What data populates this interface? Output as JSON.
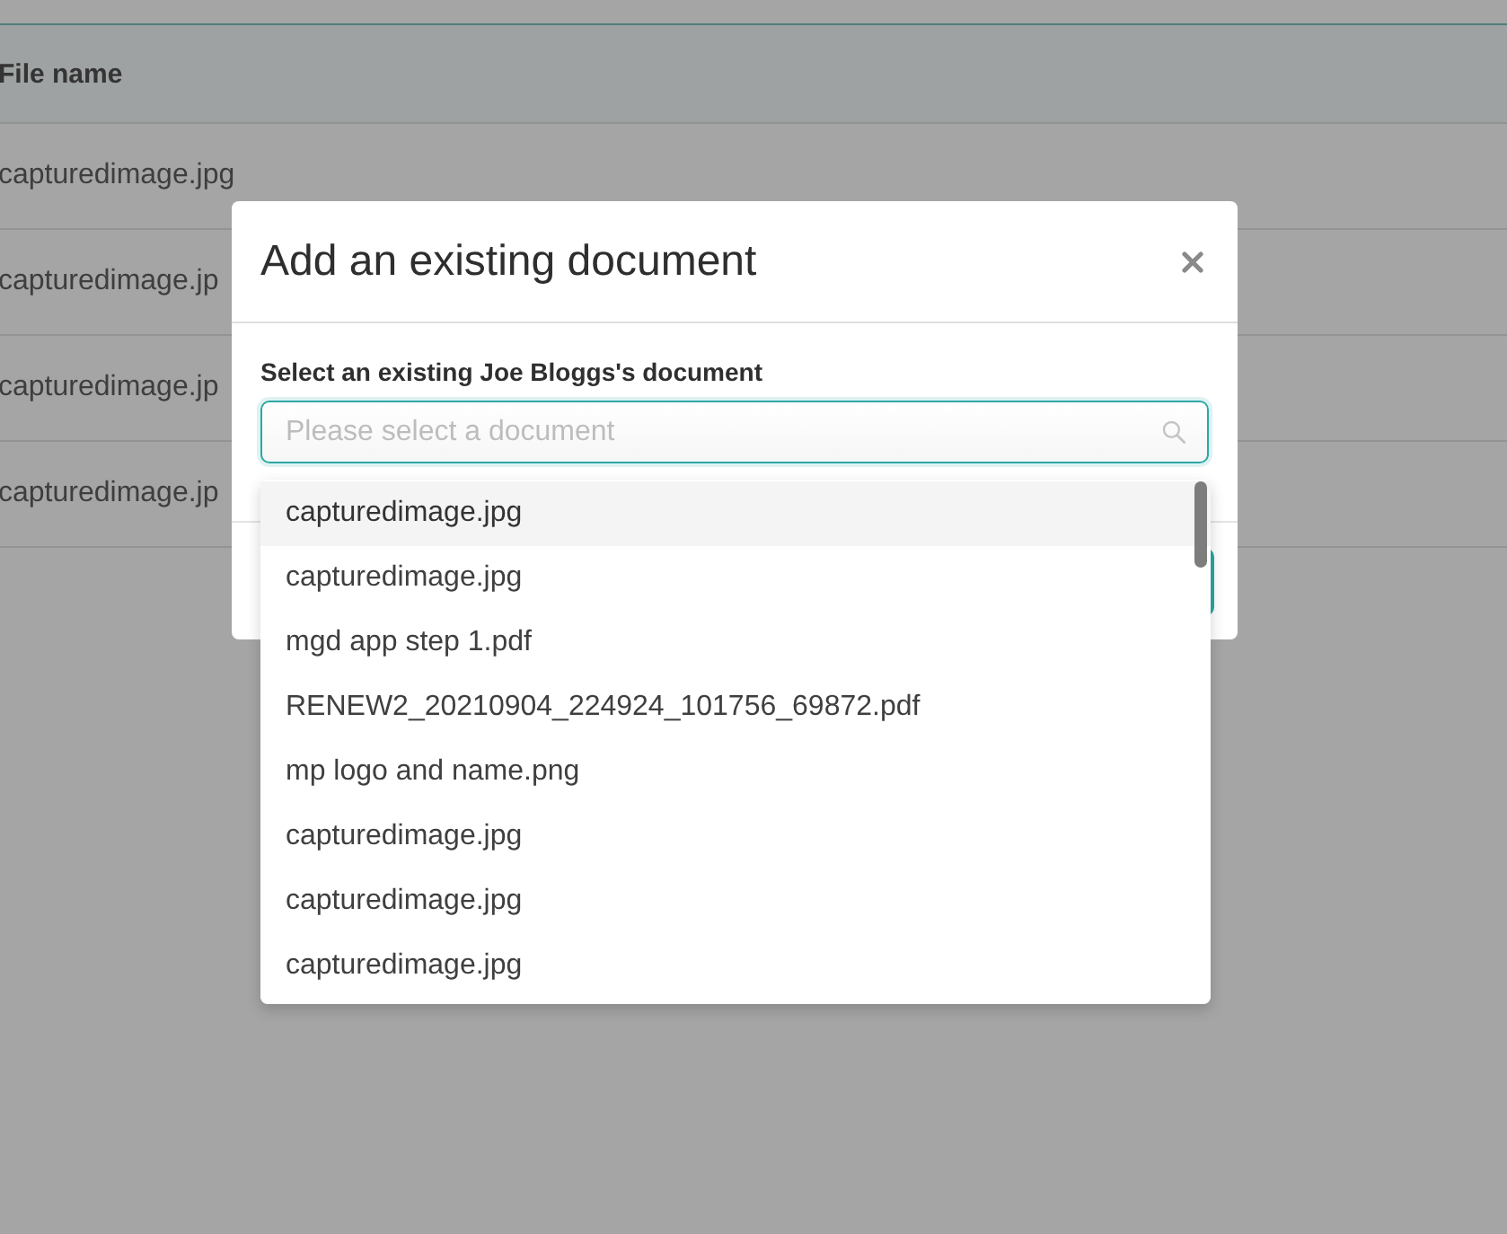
{
  "table": {
    "columns": [
      "File name"
    ],
    "rows": [
      [
        "capturedimage.jpg"
      ],
      [
        "capturedimage.jp"
      ],
      [
        "capturedimage.jp"
      ],
      [
        "capturedimage.jp"
      ]
    ]
  },
  "dialog": {
    "title": "Add an existing document",
    "field_label": "Select an existing Joe Bloggs's document",
    "search": {
      "placeholder": "Please select a document"
    },
    "dropdown": {
      "options": [
        {
          "label": "capturedimage.jpg",
          "highlighted": true
        },
        {
          "label": "capturedimage.jpg",
          "highlighted": false
        },
        {
          "label": "mgd app step 1.pdf",
          "highlighted": false
        },
        {
          "label": "RENEW2_20210904_224924_101756_69872.pdf",
          "highlighted": false
        },
        {
          "label": "mp logo and name.png",
          "highlighted": false
        },
        {
          "label": "capturedimage.jpg",
          "highlighted": false
        },
        {
          "label": "capturedimage.jpg",
          "highlighted": false
        },
        {
          "label": "capturedimage.jpg",
          "highlighted": false
        }
      ]
    }
  }
}
